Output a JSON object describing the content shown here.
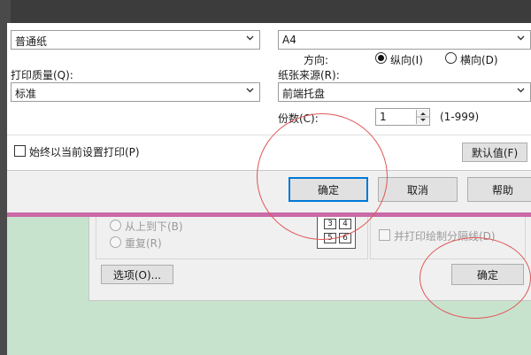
{
  "print_dialog": {
    "paper_type_value": "普通纸",
    "paper_size_value": "A4",
    "orientation_label": "方向:",
    "orientation_portrait": "纵向(I)",
    "orientation_landscape": "横向(D)",
    "print_quality_label": "打印质量(Q):",
    "print_quality_value": "标准",
    "paper_source_label": "纸张来源(R):",
    "paper_source_value": "前端托盘",
    "copies_label": "份数(C):",
    "copies_value": "1",
    "copies_range": "(1-999)",
    "always_print_label": "始终以当前设置打印(P)",
    "defaults_button": "默认值(F)",
    "ok_button": "确定",
    "cancel_button": "取消",
    "help_button": "帮助"
  },
  "page_setup": {
    "order_top_down": "从上到下(B)",
    "repeat": "重复(R)",
    "page_numbers": [
      "3",
      "4",
      "5",
      "6"
    ],
    "print_cut_lines": "并打印绘制分隔线(D)",
    "options_button": "选项(O)...",
    "ok_button": "确定"
  }
}
